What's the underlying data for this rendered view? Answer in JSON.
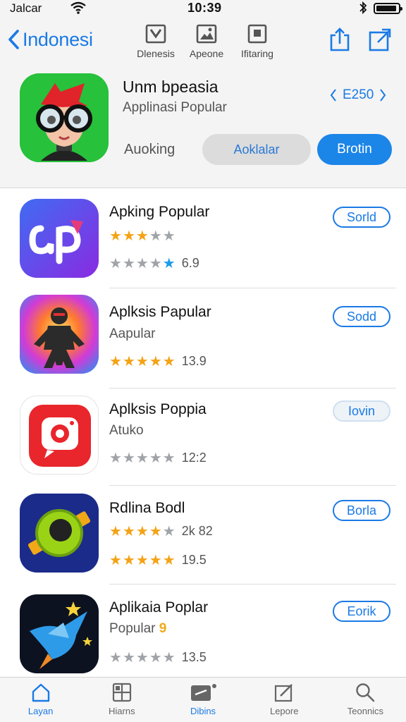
{
  "status_bar": {
    "carrier": "Jalcar",
    "time": "10:39"
  },
  "nav": {
    "back_label": "Indonesi",
    "tools": [
      {
        "label": "Dlenesis",
        "icon": "check-box-icon"
      },
      {
        "label": "Apeone",
        "icon": "image-edit-icon"
      },
      {
        "label": "Ifitaring",
        "icon": "grid-box-icon"
      }
    ],
    "right_icons": [
      "share-icon",
      "open-external-icon"
    ]
  },
  "featured": {
    "title": "Unm bpeasia",
    "subtitle": "Applinasi Popular",
    "price": "E250",
    "status": "Auoking",
    "secondary_button": "Aoklalar",
    "primary_button": "Brotin"
  },
  "apps": [
    {
      "name": "Apking Popular",
      "subtitle": "",
      "stars_top": "3.5",
      "rating": "6.9",
      "button": "Sorld",
      "button_style": "outline",
      "icon": "ap-logo-icon"
    },
    {
      "name": "Aplksis Papular",
      "subtitle": "Aapular",
      "rating": "13.9",
      "button": "Sodd",
      "button_style": "outline",
      "icon": "ninja-character-icon"
    },
    {
      "name": "Aplksis Poppia",
      "subtitle": "Atuko",
      "rating": "12:2",
      "button": "Iovin",
      "button_style": "muted",
      "icon": "camera-app-icon"
    },
    {
      "name": "Rdlina Bodl",
      "subtitle": "",
      "stars_top_label": "2k 82",
      "rating": "19.5",
      "button": "Borla",
      "button_style": "outline",
      "icon": "lime-orb-icon"
    },
    {
      "name": "Aplikaia Poplar",
      "subtitle": "Popular",
      "subtitle_badge": "9",
      "rating": "13.5",
      "button": "Eorik",
      "button_style": "outline",
      "icon": "blue-bird-icon"
    }
  ],
  "tabs": [
    {
      "label": "Layan",
      "icon": "home-icon",
      "active": true
    },
    {
      "label": "Hiarns",
      "icon": "apps-grid-icon",
      "active": false
    },
    {
      "label": "Dibins",
      "icon": "games-icon",
      "active": false
    },
    {
      "label": "Lepore",
      "icon": "edit-icon",
      "active": false
    },
    {
      "label": "Teonnics",
      "icon": "search-icon",
      "active": false
    }
  ],
  "colors": {
    "accent": "#1a7ae6",
    "primary_button": "#1b85e8",
    "star_gold": "#f4a316",
    "star_grey": "#a0a4a8"
  }
}
